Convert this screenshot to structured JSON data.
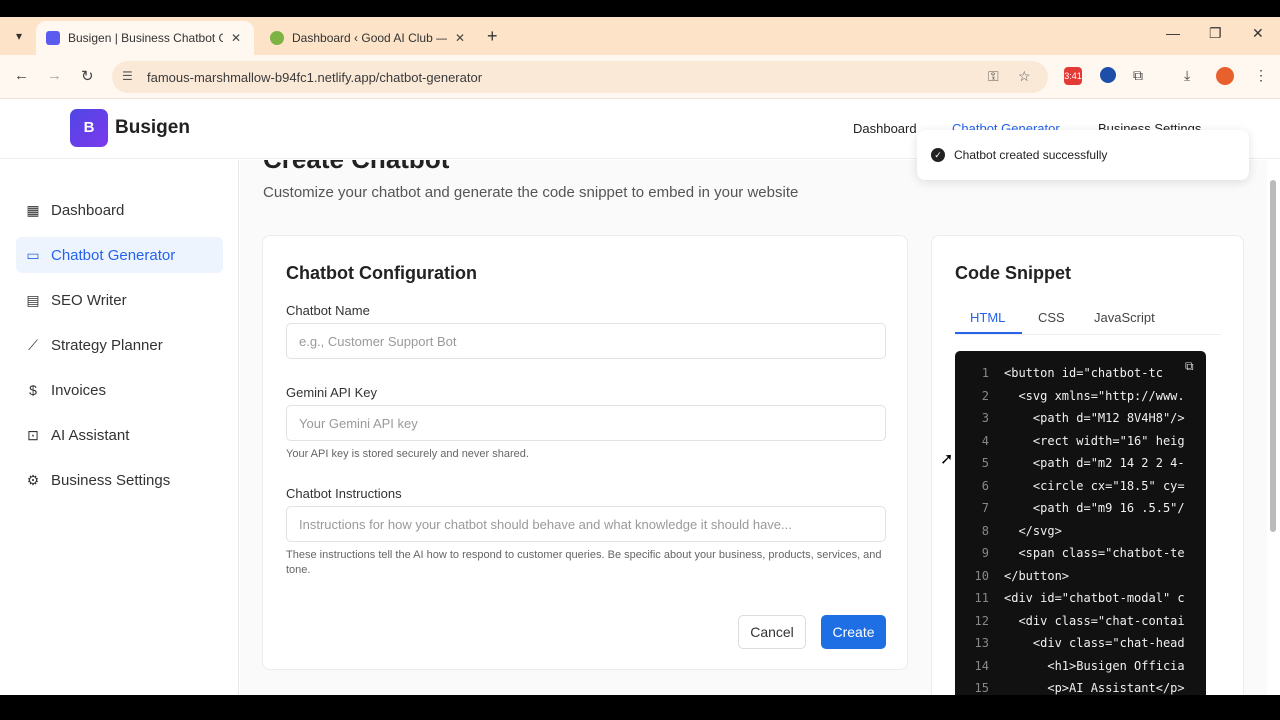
{
  "browser": {
    "tabs": [
      {
        "title": "Busigen | Business Chatbot Ger",
        "active": true
      },
      {
        "title": "Dashboard ‹ Good AI Club — W",
        "active": false
      }
    ],
    "address": "famous-marshmallow-b94fc1.netlify.app/chatbot-generator",
    "ext_badge": "3:41"
  },
  "app": {
    "logo_letter": "B",
    "name": "Busigen",
    "topnav": [
      "Dashboard",
      "Chatbot Generator",
      "Business Settings"
    ]
  },
  "toast": {
    "message": "Chatbot created successfully"
  },
  "sidebar": {
    "items": [
      {
        "label": "Dashboard",
        "icon": "dashboard-icon",
        "active": false
      },
      {
        "label": "Chatbot Generator",
        "icon": "chat-icon",
        "active": true
      },
      {
        "label": "SEO Writer",
        "icon": "document-icon",
        "active": false
      },
      {
        "label": "Strategy Planner",
        "icon": "chart-icon",
        "active": false
      },
      {
        "label": "Invoices",
        "icon": "dollar-icon",
        "active": false
      },
      {
        "label": "AI Assistant",
        "icon": "robot-icon",
        "active": false
      },
      {
        "label": "Business Settings",
        "icon": "gear-icon",
        "active": false
      }
    ]
  },
  "page": {
    "title": "Create Chatbot",
    "subtitle": "Customize your chatbot and generate the code snippet to embed in your website"
  },
  "config": {
    "title": "Chatbot Configuration",
    "name_label": "Chatbot Name",
    "name_placeholder": "e.g., Customer Support Bot",
    "key_label": "Gemini API Key",
    "key_placeholder": "Your Gemini API key",
    "key_hint": "Your API key is stored securely and never shared.",
    "instr_label": "Chatbot Instructions",
    "instr_placeholder": "Instructions for how your chatbot should behave and what knowledge it should have...",
    "instr_hint": "These instructions tell the AI how to respond to customer queries. Be specific about your business, products, services, and tone.",
    "cancel": "Cancel",
    "create": "Create"
  },
  "snippet": {
    "title": "Code Snippet",
    "tabs": [
      "HTML",
      "CSS",
      "JavaScript"
    ],
    "lines": [
      {
        "n": "1",
        "code": "<button id=\"chatbot-tc"
      },
      {
        "n": "2",
        "code": "  <svg xmlns=\"http://www."
      },
      {
        "n": "3",
        "code": "    <path d=\"M12 8V4H8\"/>"
      },
      {
        "n": "4",
        "code": "    <rect width=\"16\" heig"
      },
      {
        "n": "5",
        "code": "    <path d=\"m2 14 2 2 4-"
      },
      {
        "n": "6",
        "code": "    <circle cx=\"18.5\" cy="
      },
      {
        "n": "7",
        "code": "    <path d=\"m9 16 .5.5\"/"
      },
      {
        "n": "8",
        "code": "  </svg>"
      },
      {
        "n": "9",
        "code": "  <span class=\"chatbot-te"
      },
      {
        "n": "10",
        "code": "</button>"
      },
      {
        "n": "11",
        "code": "<div id=\"chatbot-modal\" c"
      },
      {
        "n": "12",
        "code": "  <div class=\"chat-contai"
      },
      {
        "n": "13",
        "code": "    <div class=\"chat-head"
      },
      {
        "n": "14",
        "code": "      <h1>Busigen Officia"
      },
      {
        "n": "15",
        "code": "      <p>AI Assistant</p>"
      }
    ]
  }
}
